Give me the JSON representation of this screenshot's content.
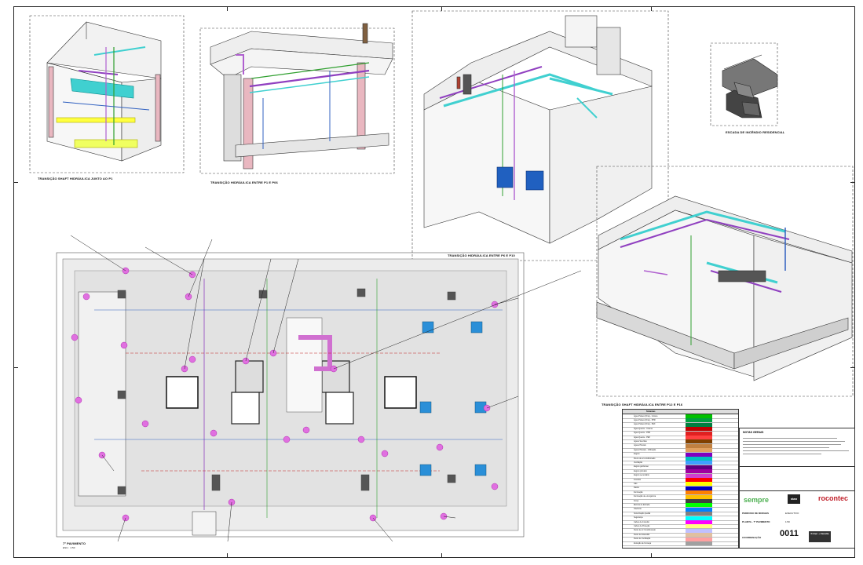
{
  "drawing": {
    "view_captions": {
      "shaft_p1": "TRANSIÇÃO SHAFT HIDRÁULICA JUNTO AO P1",
      "p1_p6": "TRANSIÇÃO HIDRÁULICA ENTRE P1 E P06",
      "p6_p10": "TRANSIÇÃO HIDRÁULICA ENTRE P6 E P10",
      "p12_p16": "TRANSIÇÃO SHAFT HIDRÁULICA ENTRE P12 E P16",
      "stair": "ESCADA DE INCÊNDIO RESIDENCIAL"
    },
    "plan_caption": "7º PAVIMENTO",
    "plan_scale": "ESC.: 1:50",
    "notes_title": "NOTAS GERAIS",
    "sheet_number": "0011",
    "project_name": "PEDROSO DE MORAES",
    "drawing_title": "PLANTA - 7º PAVIMENTO",
    "phase": "EXECUTIVO",
    "scale": "1:50",
    "coordination": "COORDENAÇÃO",
    "logos": {
      "sempre": "sempre",
      "stan": "stan",
      "rocontec": "rocontec",
      "kriner": "Kriner + Zanatta"
    }
  },
  "legend": {
    "header": "Sistemas",
    "rows": [
      {
        "label": "Água Potável (Fria) - Coluna",
        "color": "#00c000"
      },
      {
        "label": "Água Potável (Fria) - PPR",
        "color": "#00a040"
      },
      {
        "label": "Água Potável (Fria) - PEX",
        "color": "#008040"
      },
      {
        "label": "Água Quente - Coluna",
        "color": "#c00000"
      },
      {
        "label": "Água Quente - PPR",
        "color": "#e02020"
      },
      {
        "label": "Água Quente - PEX",
        "color": "#ff4040"
      },
      {
        "label": "Águas Servidas",
        "color": "#804000"
      },
      {
        "label": "Águas Pluviais",
        "color": "#c08040"
      },
      {
        "label": "Águas Pluviais - Infiltração",
        "color": "#e0a060"
      },
      {
        "label": "Esgoto",
        "color": "#8000c0"
      },
      {
        "label": "Dreno de ar condicionado",
        "color": "#00c0c0"
      },
      {
        "label": "Ventilação",
        "color": "#40a0ff"
      },
      {
        "label": "Esgoto gorduroso",
        "color": "#600080"
      },
      {
        "label": "Esgoto primário",
        "color": "#a000a0"
      },
      {
        "label": "Esgoto secundário",
        "color": "#d040d0"
      },
      {
        "label": "Incêndio",
        "color": "#ff0000"
      },
      {
        "label": "Gás",
        "color": "#ffff00"
      },
      {
        "label": "Dados",
        "color": "#0000c0"
      },
      {
        "label": "Iluminação",
        "color": "#ff8000"
      },
      {
        "label": "Iluminação de emergência",
        "color": "#ffc000"
      },
      {
        "label": "Força",
        "color": "#404040"
      },
      {
        "label": "Elétrica de Entrada",
        "color": "#00ff00"
      },
      {
        "label": "Telefonia",
        "color": "#0080ff"
      },
      {
        "label": "Sonorização predial",
        "color": "#808080"
      },
      {
        "label": "Segurança",
        "color": "#00ffff"
      },
      {
        "label": "Cabos de Incêndio",
        "color": "#ff00ff"
      },
      {
        "label": "Cabos de Proteção",
        "color": "#ffff80"
      },
      {
        "label": "Dutos de Ar Condicionado",
        "color": "#c0c0ff"
      },
      {
        "label": "Dutos de Exaustão",
        "color": "#e0c0a0"
      },
      {
        "label": "Dutos de Ventilação",
        "color": "#ffa0a0"
      },
      {
        "label": "Extração de Fumaça",
        "color": "#a0a0a0"
      }
    ]
  }
}
